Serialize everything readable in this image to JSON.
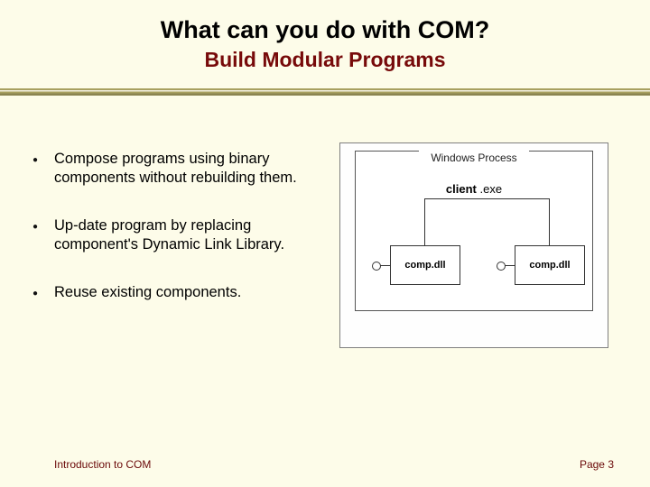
{
  "title": {
    "main": "What can you do with COM?",
    "sub": "Build Modular Programs"
  },
  "bullets": [
    "Compose programs using binary components without rebuilding them.",
    "Up-date program by replacing component's Dynamic Link Library.",
    "Reuse existing components."
  ],
  "diagram": {
    "process_label": "Windows Process",
    "client_label_bold": "client",
    "client_label_rest": " .exe",
    "comp_left": "comp.dll",
    "comp_right": "comp.dll"
  },
  "footer": {
    "left": "Introduction to COM",
    "right": "Page 3"
  }
}
